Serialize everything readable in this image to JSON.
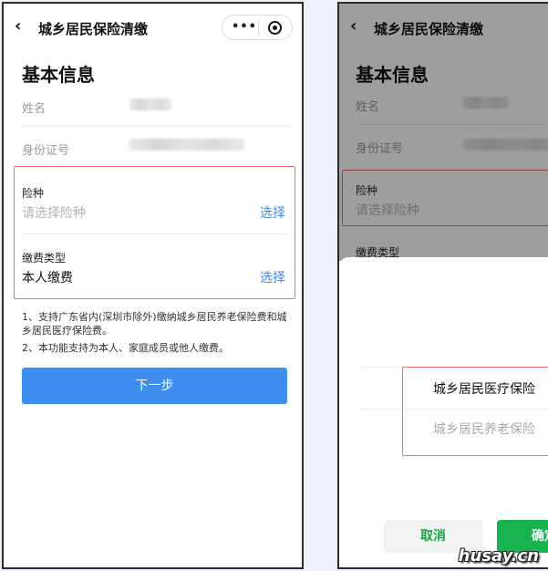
{
  "left": {
    "nav": {
      "back_glyph": "‹",
      "title": "城乡居民保险清缴",
      "more_glyph": "•••"
    },
    "section_title": "基本信息",
    "name_label": "姓名",
    "id_label": "身份证号",
    "insurance": {
      "label": "险种",
      "placeholder": "请选择险种",
      "action": "选择"
    },
    "payment": {
      "label": "缴费类型",
      "value": "本人缴费",
      "action": "选择"
    },
    "notes": [
      "1、支持广东省内(深圳市除外)缴纳城乡居民养老保险费和城乡居民医疗保险费。",
      "2、本功能支持为本人、家庭成员或他人缴费。"
    ],
    "next_button": "下一步"
  },
  "right": {
    "nav": {
      "back_glyph": "‹",
      "title": "城乡居民保险清缴"
    },
    "section_title": "基本信息",
    "name_label": "姓名",
    "id_label": "身份证号",
    "insurance": {
      "label": "险种",
      "placeholder": "请选择险种"
    },
    "payment_label_partial": "缴费类型",
    "picker": {
      "options": [
        "城乡居民医疗保险",
        "城乡居民养老保险"
      ],
      "selected_index": 0
    },
    "cancel_button": "取消",
    "confirm_button": "确定"
  },
  "watermark": "husay.cn",
  "colors": {
    "link": "#3d88e8",
    "primary": "#3e8ef0",
    "highlight": "#e8736a",
    "confirm": "#16b34f"
  }
}
